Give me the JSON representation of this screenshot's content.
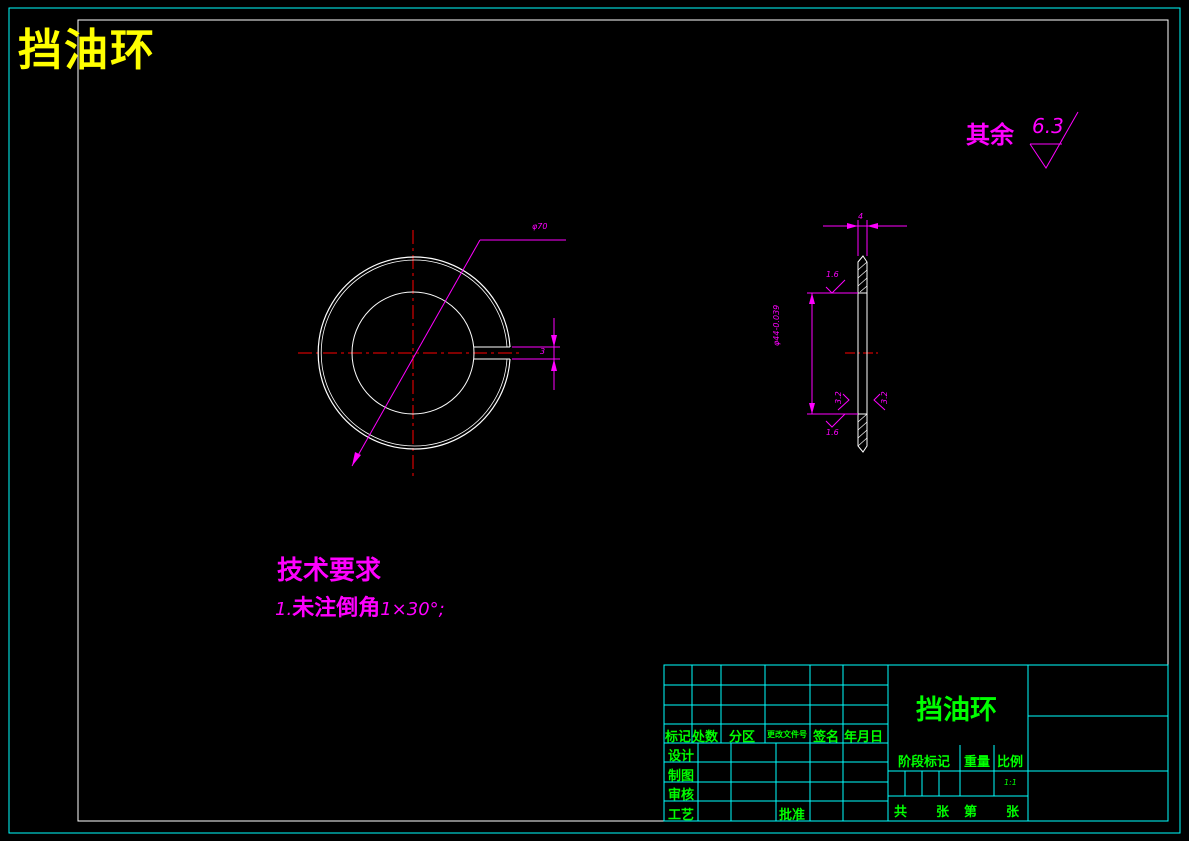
{
  "drawing": {
    "title_topleft": "挡油环",
    "surface_roughness": {
      "label": "其余",
      "value": "6.3"
    },
    "dimensions": {
      "outer_dia": "φ70",
      "thickness": "4",
      "inner_dia": "φ44-0.039",
      "gap": "3",
      "ra_top": "1.6",
      "ra_bottom": "1.6",
      "ra_inner": "3.2",
      "ra_face": "3.2"
    },
    "tech_requirements": {
      "title": "技术要求",
      "item1_num": "1.",
      "item1_text": "未注倒角",
      "item1_spec": "1×30°;"
    },
    "title_block": {
      "part_name": "挡油环",
      "hdr_mark": "标记",
      "hdr_count": "处数",
      "hdr_zone": "分区",
      "hdr_docno": "更改文件号",
      "hdr_sign": "签名",
      "hdr_date": "年月日",
      "design": "设计",
      "draw": "制图",
      "check": "审核",
      "process": "工艺",
      "approve": "批准",
      "stage_mark": "阶段标记",
      "weight": "重量",
      "scale": "比例",
      "scale_value": "1:1",
      "total": "共",
      "sheet": "张",
      "no": "第",
      "sheet2": "张"
    },
    "colors": {
      "border": "#00ffff",
      "center_line": "#ff0000",
      "dimension": "#ff00ff",
      "outline": "#ffffff",
      "title_text": "#ffff00",
      "title_block_text": "#00ff00"
    }
  }
}
